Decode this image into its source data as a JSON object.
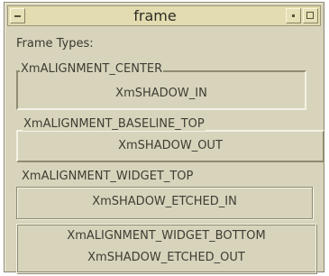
{
  "window": {
    "title": "frame"
  },
  "content": {
    "frame_types_label": "Frame Types:"
  },
  "frames": [
    {
      "title": "XmALIGNMENT_CENTER",
      "child": "XmSHADOW_IN"
    },
    {
      "title": "XmALIGNMENT_BASELINE_TOP",
      "child": "XmSHADOW_OUT"
    },
    {
      "title": "XmALIGNMENT_WIDGET_TOP",
      "child": "XmSHADOW_ETCHED_IN"
    },
    {
      "title": "XmALIGNMENT_WIDGET_BOTTOM",
      "child": "XmSHADOW_ETCHED_OUT"
    }
  ]
}
